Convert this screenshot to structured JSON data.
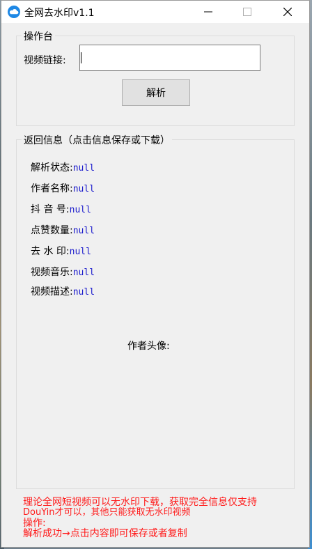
{
  "window": {
    "title": "全网去水印v1.1"
  },
  "operation_panel": {
    "legend": "操作台",
    "url_label": "视频链接:",
    "url_value": "",
    "parse_button": "解析"
  },
  "info_panel": {
    "legend": "返回信息（点击信息保存或下载）",
    "rows": [
      {
        "label": "解析状态:",
        "value": "null"
      },
      {
        "label": "作者名称:",
        "value": "null"
      },
      {
        "label": "抖 音 号:",
        "value": "null"
      },
      {
        "label": "点赞数量:",
        "value": "null"
      },
      {
        "label": "去 水 印:",
        "value": "null"
      },
      {
        "label": "视频音乐:",
        "value": "null"
      },
      {
        "label": "视频描述:",
        "value": "null"
      }
    ],
    "avatar_label": "作者头像:"
  },
  "notes": [
    "理论全网短视频可以无水印下载，获取完全信息仅支持",
    "DouYin才可以，其他只能获取无水印视频",
    "操作:",
    "解析成功→点击内容即可保存或者复制"
  ],
  "colors": {
    "null_value": "#1a1acc",
    "note_text": "#ff1a1a"
  }
}
